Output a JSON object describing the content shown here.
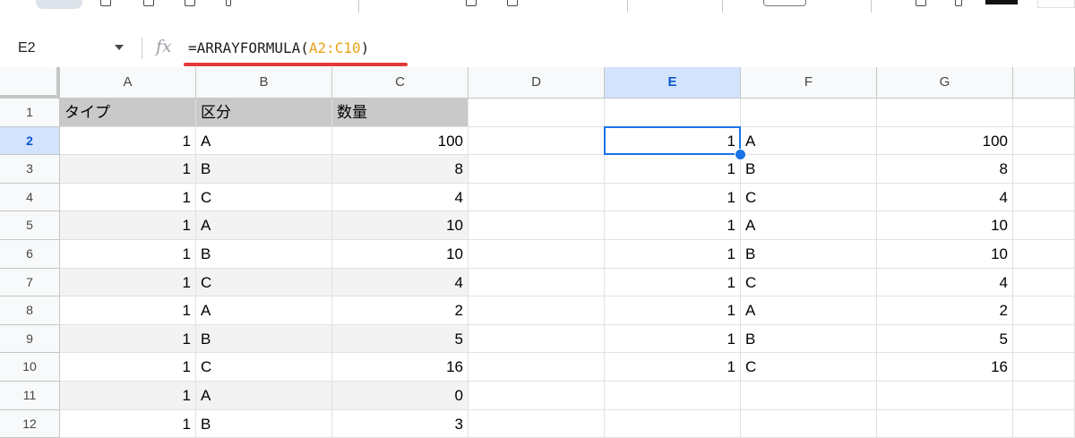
{
  "formula_bar": {
    "name_box": "E2",
    "fx_label": "fx",
    "formula_prefix": "=ARRAYFORMULA(",
    "formula_ref": "A2:C10",
    "formula_suffix": ")"
  },
  "columns": [
    "A",
    "B",
    "C",
    "D",
    "E",
    "F",
    "G"
  ],
  "selected_cell": "E2",
  "rows": [
    {
      "n": "1",
      "a": "タイプ",
      "b": "区分",
      "c": "数量",
      "e": "",
      "f": "",
      "g": ""
    },
    {
      "n": "2",
      "a": "1",
      "b": "A",
      "c": "100",
      "e": "1",
      "f": "A",
      "g": "100"
    },
    {
      "n": "3",
      "a": "1",
      "b": "B",
      "c": "8",
      "e": "1",
      "f": "B",
      "g": "8"
    },
    {
      "n": "4",
      "a": "1",
      "b": "C",
      "c": "4",
      "e": "1",
      "f": "C",
      "g": "4"
    },
    {
      "n": "5",
      "a": "1",
      "b": "A",
      "c": "10",
      "e": "1",
      "f": "A",
      "g": "10"
    },
    {
      "n": "6",
      "a": "1",
      "b": "B",
      "c": "10",
      "e": "1",
      "f": "B",
      "g": "10"
    },
    {
      "n": "7",
      "a": "1",
      "b": "C",
      "c": "4",
      "e": "1",
      "f": "C",
      "g": "4"
    },
    {
      "n": "8",
      "a": "1",
      "b": "A",
      "c": "2",
      "e": "1",
      "f": "A",
      "g": "2"
    },
    {
      "n": "9",
      "a": "1",
      "b": "B",
      "c": "5",
      "e": "1",
      "f": "B",
      "g": "5"
    },
    {
      "n": "10",
      "a": "1",
      "b": "C",
      "c": "16",
      "e": "1",
      "f": "C",
      "g": "16"
    },
    {
      "n": "11",
      "a": "1",
      "b": "A",
      "c": "0",
      "e": "",
      "f": "",
      "g": ""
    },
    {
      "n": "12",
      "a": "1",
      "b": "B",
      "c": "3",
      "e": "",
      "f": "",
      "g": ""
    }
  ],
  "colors": {
    "header_fill": "#c9c9c9",
    "band_fill": "#f3f3f3",
    "selection": "#1a73e8",
    "formula_ref": "#e8a317",
    "annotation_underline": "#e53935"
  }
}
